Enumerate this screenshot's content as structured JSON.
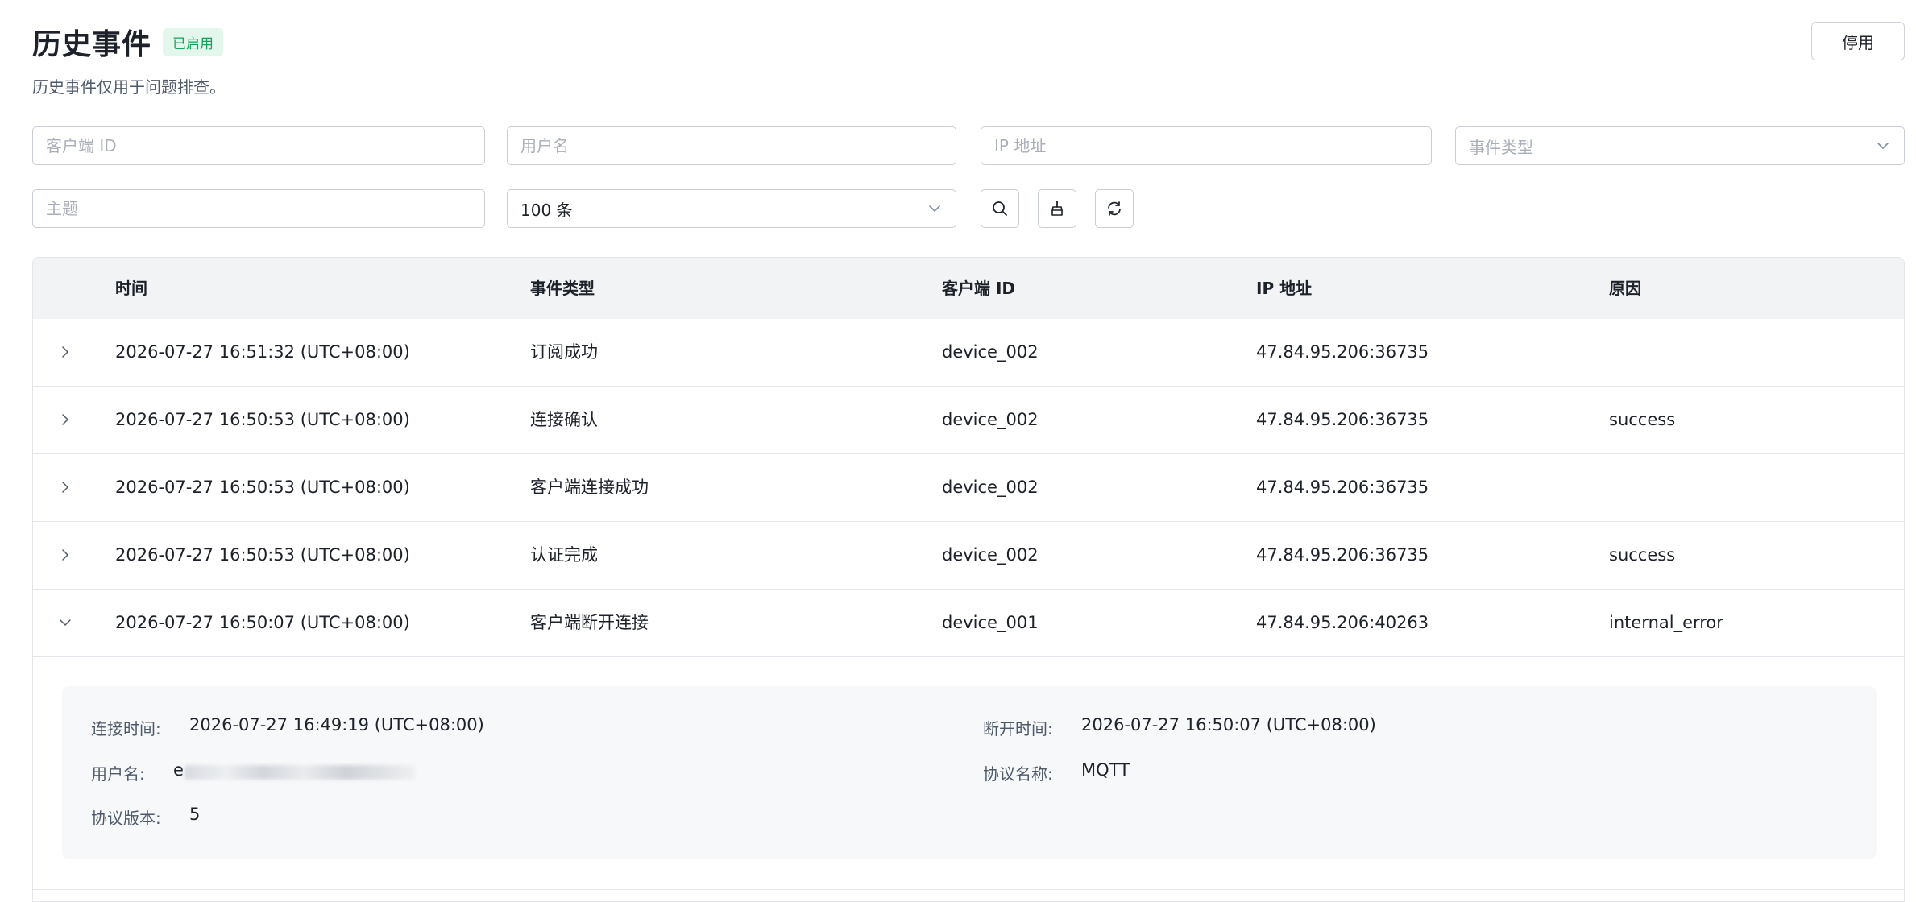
{
  "header": {
    "title": "历史事件",
    "status_badge": "已启用",
    "subtitle": "历史事件仅用于问题排查。",
    "disable_label": "停用"
  },
  "filters": {
    "client_id_placeholder": "客户端 ID",
    "username_placeholder": "用户名",
    "ip_placeholder": "IP 地址",
    "event_type_placeholder": "事件类型",
    "topic_placeholder": "主题",
    "limit_value": "100 条"
  },
  "toolbar": {
    "search_icon": "search-icon",
    "clear_icon": "broom-icon",
    "refresh_icon": "refresh-icon"
  },
  "table": {
    "columns": [
      "时间",
      "事件类型",
      "客户端 ID",
      "IP 地址",
      "原因"
    ],
    "rows": [
      {
        "time": "2026-07-27 16:51:32 (UTC+08:00)",
        "type": "订阅成功",
        "client": "device_002",
        "ip": "47.84.95.206:36735",
        "reason": ""
      },
      {
        "time": "2026-07-27 16:50:53 (UTC+08:00)",
        "type": "连接确认",
        "client": "device_002",
        "ip": "47.84.95.206:36735",
        "reason": "success"
      },
      {
        "time": "2026-07-27 16:50:53 (UTC+08:00)",
        "type": "客户端连接成功",
        "client": "device_002",
        "ip": "47.84.95.206:36735",
        "reason": ""
      },
      {
        "time": "2026-07-27 16:50:53 (UTC+08:00)",
        "type": "认证完成",
        "client": "device_002",
        "ip": "47.84.95.206:36735",
        "reason": "success"
      },
      {
        "time": "2026-07-27 16:50:07 (UTC+08:00)",
        "type": "客户端断开连接",
        "client": "device_001",
        "ip": "47.84.95.206:40263",
        "reason": "internal_error"
      }
    ],
    "detail": {
      "connect_time_label": "连接时间:",
      "connect_time_value": "2026-07-27 16:49:19 (UTC+08:00)",
      "disconnect_time_label": "断开时间:",
      "disconnect_time_value": "2026-07-27 16:50:07 (UTC+08:00)",
      "username_label": "用户名:",
      "username_value_prefix": "e",
      "protocol_name_label": "协议名称:",
      "protocol_name_value": "MQTT",
      "protocol_version_label": "协议版本:",
      "protocol_version_value": "5"
    }
  },
  "colors": {
    "accent_green": "#13a35c",
    "badge_bg": "#e3f7ec",
    "header_bg": "#f2f3f5",
    "detail_bg": "#f7f8fa"
  }
}
